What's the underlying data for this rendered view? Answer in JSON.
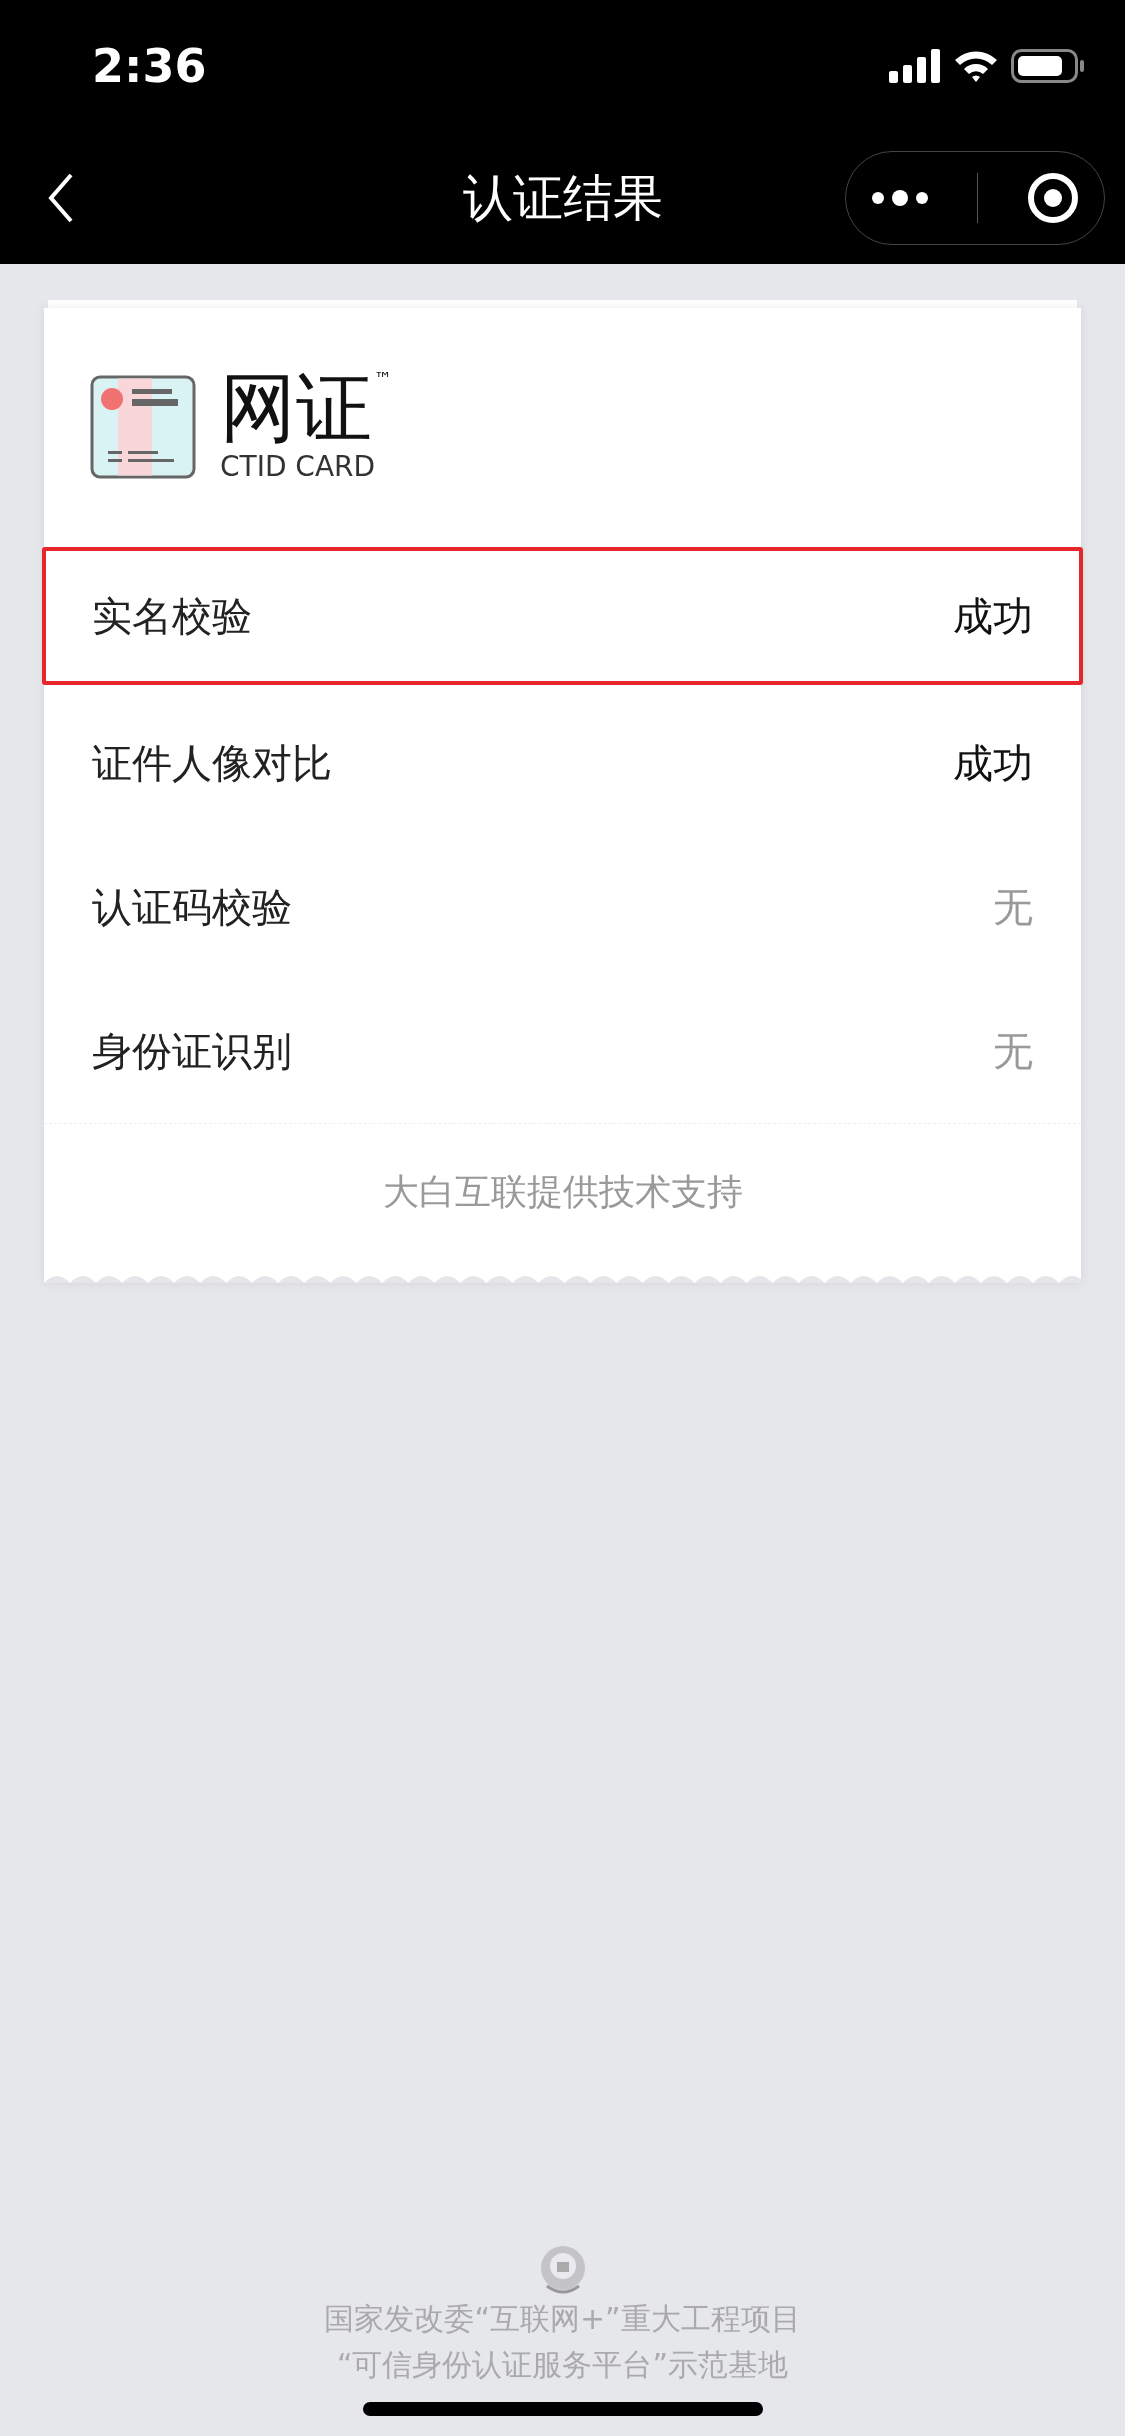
{
  "status_bar": {
    "time": "2:36"
  },
  "nav": {
    "title": "认证结果"
  },
  "logo": {
    "name": "网证",
    "trademark": "™",
    "subtitle": "CTID CARD"
  },
  "results": [
    {
      "label": "实名校验",
      "value": "成功",
      "kind": "success",
      "highlighted": true
    },
    {
      "label": "证件人像对比",
      "value": "成功",
      "kind": "success",
      "highlighted": false
    },
    {
      "label": "认证码校验",
      "value": "无",
      "kind": "none",
      "highlighted": false
    },
    {
      "label": "身份证识别",
      "value": "无",
      "kind": "none",
      "highlighted": false
    }
  ],
  "credit": "大白互联提供技术支持",
  "footer": [
    "国家发改委“互联网+”重大工程项目",
    "“可信身份认证服务平台”示范基地"
  ]
}
